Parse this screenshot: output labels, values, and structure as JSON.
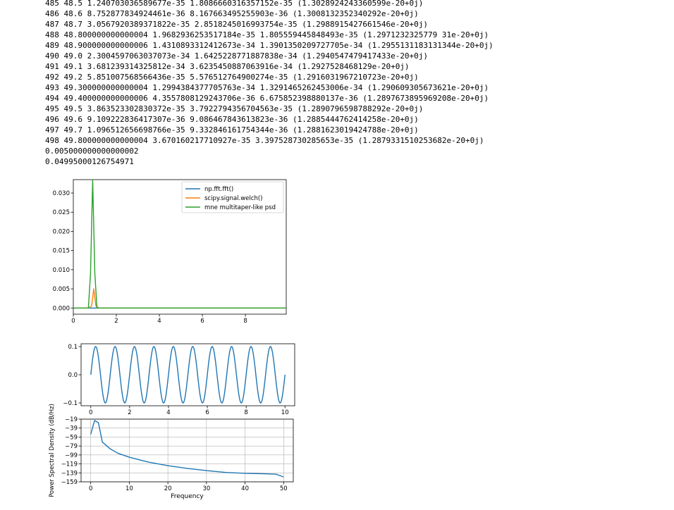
{
  "output_lines": [
    "485 48.5 1.240703036589677e-35 1.8086660316357152e-35 (1.3028924243360599e-20+0j)",
    "486 48.6 8.752877834924461e-36 8.167663495255903e-36 (1.3008132352340292e-20+0j)",
    "487 48.7 3.0567920389371822e-35 2.8518245016993754e-35 (1.2988915427661546e-20+0j)",
    "488 48.800000000000004 1.9682936253517184e-35 1.805559445848493e-35 (1.2971232325779 31e-20+0j)",
    "489 48.900000000000006 1.4310893312412673e-34 1.3901350209727705e-34 (1.2955131183131344e-20+0j)",
    "490 49.0 2.3004597063037073e-34 1.6425228771887838e-34 (1.2940547479417433e-20+0j)",
    "491 49.1 3.681239314325812e-34 3.6235450887063916e-34 (1.2927528468129e-20+0j)",
    "492 49.2 5.851007568566436e-35 5.576512764900274e-35 (1.2916031967210723e-20+0j)",
    "493 49.300000000000004 1.2994384377705763e-34 1.3291465262453006e-34 (1.290609305673621e-20+0j)",
    "494 49.400000000000006 4.3557808129243706e-36 6.675852398880137e-36 (1.2897673895969208e-20+0j)",
    "495 49.5 3.863523302830372e-35 3.7922794356704563e-35 (1.2890796598788292e-20+0j)",
    "496 49.6 9.109222836417307e-36 9.086467843613823e-36 (1.2885444762414258e-20+0j)",
    "497 49.7 1.096512656698766e-35 9.332846161754344e-36 (1.2881623019424788e-20+0j)",
    "498 49.800000000000004 3.670160217710927e-35 3.397528730285653e-35 (1.2879331510253682e-20+0j)",
    "0.005000000000000002",
    "0.04995000126754971"
  ],
  "colors": {
    "fft": "#1f77b4",
    "welch": "#ff7f0e",
    "multitaper": "#2ca02c",
    "axis": "#000000",
    "grid": "#b0b0b0"
  },
  "chart_data": [
    {
      "type": "line",
      "title": "",
      "xlabel": "",
      "ylabel": "",
      "xlim": [
        0,
        9.9
      ],
      "ylim": [
        -0.0016,
        0.0335
      ],
      "xticks": [
        0,
        2,
        4,
        6,
        8
      ],
      "xtick_labels": [
        "0",
        "2",
        "4",
        "6",
        "8"
      ],
      "yticks": [
        0,
        0.005,
        0.01,
        0.015,
        0.02,
        0.025,
        0.03
      ],
      "ytick_labels": [
        "0.000",
        "0.005",
        "0.010",
        "0.015",
        "0.020",
        "0.025",
        "0.030"
      ],
      "grid": false,
      "legend_position": "upper right",
      "series": [
        {
          "name": "np.fft.fft()",
          "color_key": "fft",
          "x": [
            0,
            0.5,
            0.8,
            0.9,
            1.0,
            1.1,
            1.2,
            1.5,
            9.9
          ],
          "y": [
            0,
            0,
            0,
            0,
            0,
            0,
            0,
            0,
            0
          ]
        },
        {
          "name": "scipy.signal.welch()",
          "color_key": "welch",
          "x": [
            0,
            0.7,
            0.85,
            0.95,
            1.05,
            1.2,
            9.9
          ],
          "y": [
            0,
            0,
            0.0005,
            0.005,
            0.0005,
            0,
            0
          ]
        },
        {
          "name": "mne multitaper-like psd",
          "color_key": "multitaper",
          "x": [
            0,
            0.7,
            0.8,
            0.9,
            1.0,
            1.1,
            9.9
          ],
          "y": [
            0,
            0,
            0.009,
            0.0335,
            0.009,
            0,
            0
          ]
        }
      ]
    },
    {
      "type": "line",
      "title": "",
      "xlabel": "",
      "ylabel": "",
      "xlim": [
        -0.5,
        10.5
      ],
      "ylim": [
        -0.11,
        0.11
      ],
      "xticks": [
        0,
        2,
        4,
        6,
        8,
        10
      ],
      "xtick_labels": [
        "0",
        "2",
        "4",
        "6",
        "8",
        "10"
      ],
      "yticks": [
        -0.1,
        0,
        0.1
      ],
      "ytick_labels": [
        "−0.1",
        "0.0",
        "0.1"
      ],
      "grid": false,
      "signal": {
        "amplitude": 0.1,
        "frequency_hz": 1,
        "x_start": 0,
        "x_end": 10
      },
      "series": [
        {
          "color_key": "fft"
        }
      ]
    },
    {
      "type": "line",
      "title": "",
      "xlabel": "Frequency",
      "ylabel": "Power Spectral Density (dB/Hz)",
      "xlim": [
        -2.5,
        52.5
      ],
      "ylim": [
        -159,
        -19
      ],
      "xticks": [
        0,
        10,
        20,
        30,
        40,
        50
      ],
      "xtick_labels": [
        "0",
        "10",
        "20",
        "30",
        "40",
        "50"
      ],
      "yticks": [
        -19,
        -39,
        -59,
        -79,
        -99,
        -119,
        -139,
        -159
      ],
      "ytick_labels": [
        "−19",
        "−39",
        "−59",
        "−79",
        "−99",
        "−119",
        "−139",
        "−159"
      ],
      "grid": true,
      "series": [
        {
          "color_key": "fft",
          "x": [
            0,
            1,
            2,
            3,
            5,
            7,
            10,
            15,
            20,
            25,
            30,
            35,
            40,
            45,
            48,
            49,
            50
          ],
          "y": [
            -53,
            -22,
            -27,
            -70,
            -85,
            -95,
            -104,
            -115,
            -123,
            -129,
            -134,
            -138,
            -140,
            -141,
            -142,
            -145,
            -148
          ]
        }
      ]
    }
  ]
}
